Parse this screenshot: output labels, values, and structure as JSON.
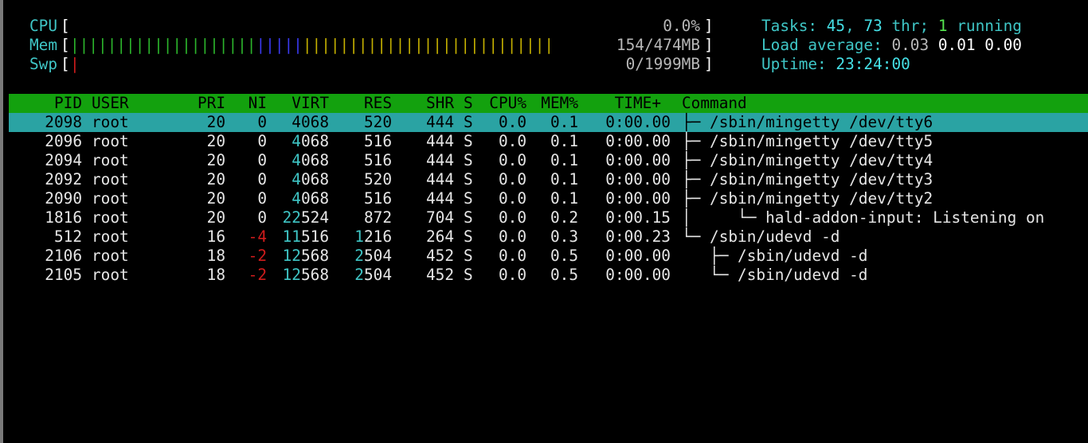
{
  "meters": {
    "cpu": {
      "label": "CPU",
      "open": "[",
      "bars": "",
      "value": "0.0%",
      "close": "]"
    },
    "mem": {
      "label": "Mem",
      "open": "[",
      "bars_green": "||||||||||||||||||||",
      "bars_blue": "|||||",
      "bars_yellow": "|||||||||||||||||||||||||||",
      "value": "154/474MB",
      "close": "]"
    },
    "swp": {
      "label": "Swp",
      "open": "[",
      "bars_red": "|",
      "value": "0/1999MB",
      "close": "]"
    }
  },
  "summary": {
    "tasks_label": "Tasks: ",
    "tasks_count": "45",
    "tasks_sep": ", ",
    "threads_count": "73",
    "threads_label": " thr; ",
    "running_count": "1",
    "running_label": " running",
    "load_label": "Load average: ",
    "load_1": "0.03",
    "load_5": "0.01",
    "load_15": "0.00",
    "uptime_label": "Uptime: ",
    "uptime_value": "23:24:00"
  },
  "columns": {
    "pid": "PID",
    "user": "USER",
    "pri": "PRI",
    "ni": "NI",
    "virt": "VIRT",
    "res": "RES",
    "shr": "SHR",
    "s": "S",
    "cpu": "CPU%",
    "mem": "MEM%",
    "time": "TIME+",
    "command": "Command"
  },
  "processes": [
    {
      "pid": "2098",
      "user": "root",
      "pri": "20",
      "ni": "0",
      "virt": "4068",
      "res": "520",
      "shr": "444",
      "s": "S",
      "cpu": "0.0",
      "mem": "0.1",
      "time": "0:00.00",
      "tree": "├─ ",
      "command": "/sbin/mingetty /dev/tty6"
    },
    {
      "pid": "2096",
      "user": "root",
      "pri": "20",
      "ni": "0",
      "virt": "4068",
      "res": "516",
      "shr": "444",
      "s": "S",
      "cpu": "0.0",
      "mem": "0.1",
      "time": "0:00.00",
      "tree": "├─ ",
      "command": "/sbin/mingetty /dev/tty5"
    },
    {
      "pid": "2094",
      "user": "root",
      "pri": "20",
      "ni": "0",
      "virt": "4068",
      "res": "516",
      "shr": "444",
      "s": "S",
      "cpu": "0.0",
      "mem": "0.1",
      "time": "0:00.00",
      "tree": "├─ ",
      "command": "/sbin/mingetty /dev/tty4"
    },
    {
      "pid": "2092",
      "user": "root",
      "pri": "20",
      "ni": "0",
      "virt": "4068",
      "res": "520",
      "shr": "444",
      "s": "S",
      "cpu": "0.0",
      "mem": "0.1",
      "time": "0:00.00",
      "tree": "├─ ",
      "command": "/sbin/mingetty /dev/tty3"
    },
    {
      "pid": "2090",
      "user": "root",
      "pri": "20",
      "ni": "0",
      "virt": "4068",
      "res": "516",
      "shr": "444",
      "s": "S",
      "cpu": "0.0",
      "mem": "0.1",
      "time": "0:00.00",
      "tree": "├─ ",
      "command": "/sbin/mingetty /dev/tty2"
    },
    {
      "pid": "1816",
      "user": "root",
      "pri": "20",
      "ni": "0",
      "virt": "22524",
      "res": "872",
      "shr": "704",
      "s": "S",
      "cpu": "0.0",
      "mem": "0.2",
      "time": "0:00.15",
      "tree": "│     └─ ",
      "command": "hald-addon-input: Listening on"
    },
    {
      "pid": "512",
      "user": "root",
      "pri": "16",
      "ni": "-4",
      "virt": "11516",
      "res": "1216",
      "shr": "264",
      "s": "S",
      "cpu": "0.0",
      "mem": "0.3",
      "time": "0:00.23",
      "tree": "└─ ",
      "command": "/sbin/udevd -d"
    },
    {
      "pid": "2106",
      "user": "root",
      "pri": "18",
      "ni": "-2",
      "virt": "12568",
      "res": "2504",
      "shr": "452",
      "s": "S",
      "cpu": "0.0",
      "mem": "0.5",
      "time": "0:00.00",
      "tree": "   ├─ ",
      "command": "/sbin/udevd -d"
    },
    {
      "pid": "2105",
      "user": "root",
      "pri": "18",
      "ni": "-2",
      "virt": "12568",
      "res": "2504",
      "shr": "452",
      "s": "S",
      "cpu": "0.0",
      "mem": "0.5",
      "time": "0:00.00",
      "tree": "   └─ ",
      "command": "/sbin/udevd -d"
    }
  ],
  "colors": {
    "header_bg": "#13a10e",
    "selected_bg": "#2aa3a3",
    "cyan": "#3fc6c6",
    "red": "#d01c1c"
  }
}
